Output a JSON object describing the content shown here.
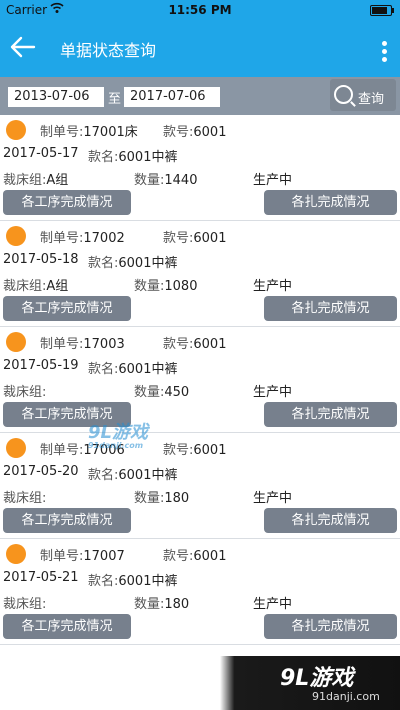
{
  "status_bar": {
    "carrier": "Carrier",
    "time": "11:56 PM",
    "battery_level": 0.9
  },
  "header": {
    "title": "单据状态查询"
  },
  "search": {
    "date_from": "2013-07-06",
    "to_label": "至",
    "date_to": "2017-07-06",
    "query_label": "查询"
  },
  "labels": {
    "order_no": "制单号:",
    "style_no": "款号:",
    "style_name": "款名:",
    "cut_group": "裁床组:",
    "quantity": "数量:",
    "process_button": "各工序完成情况",
    "bundle_button": "各扎完成情况"
  },
  "orders": [
    {
      "order_no": "17001床",
      "style_no": "6001",
      "date": "2017-05-17",
      "style_name": "6001中裤",
      "cut_group": "A组",
      "quantity": "1440",
      "status": "生产中"
    },
    {
      "order_no": "17002",
      "style_no": "6001",
      "date": "2017-05-18",
      "style_name": "6001中裤",
      "cut_group": "A组",
      "quantity": "1080",
      "status": "生产中"
    },
    {
      "order_no": "17003",
      "style_no": "6001",
      "date": "2017-05-19",
      "style_name": "6001中裤",
      "cut_group": "",
      "quantity": "450",
      "status": "生产中"
    },
    {
      "order_no": "17006",
      "style_no": "6001",
      "date": "2017-05-20",
      "style_name": "6001中裤",
      "cut_group": "",
      "quantity": "180",
      "status": "生产中"
    },
    {
      "order_no": "17007",
      "style_no": "6001",
      "date": "2017-05-21",
      "style_name": "6001中裤",
      "cut_group": "",
      "quantity": "180",
      "status": "生产中"
    }
  ],
  "watermark": {
    "text": "9L游戏",
    "sub": "91danji.com"
  },
  "brand": {
    "text": "9L游戏",
    "sub": "91danji.com"
  },
  "colors": {
    "accent": "#1fa6e8",
    "status_dot": "#f7941d",
    "button": "#77808d",
    "search_bar": "#8a96a4"
  }
}
